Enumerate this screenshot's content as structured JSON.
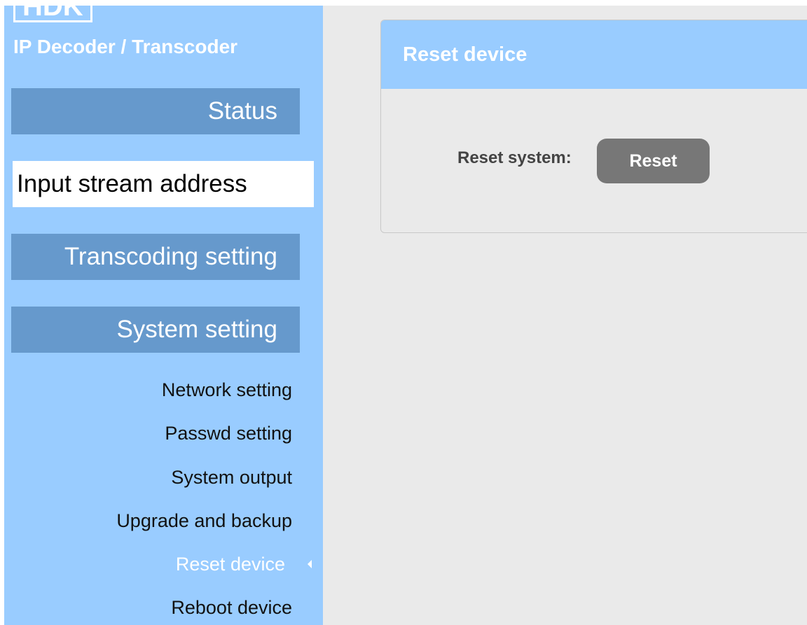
{
  "brand": {
    "logo_text": "HDK",
    "product_name": "IP Decoder / Transcoder"
  },
  "sidebar": {
    "main_items": [
      {
        "label": "Status"
      },
      {
        "label": "Input stream address"
      },
      {
        "label": "Transcoding setting"
      },
      {
        "label": "System setting"
      }
    ],
    "sub_items": [
      {
        "label": "Network setting"
      },
      {
        "label": "Passwd setting"
      },
      {
        "label": "System output"
      },
      {
        "label": "Upgrade and backup"
      },
      {
        "label": "Reset device"
      },
      {
        "label": "Reboot device"
      }
    ]
  },
  "panel": {
    "title": "Reset device",
    "reset_label": "Reset system:",
    "reset_button": "Reset"
  },
  "colors": {
    "sidebar_bg": "#99ccff",
    "nav_block_bg": "#6699cc",
    "main_bg": "#eaeaea",
    "button_bg": "#777777"
  }
}
